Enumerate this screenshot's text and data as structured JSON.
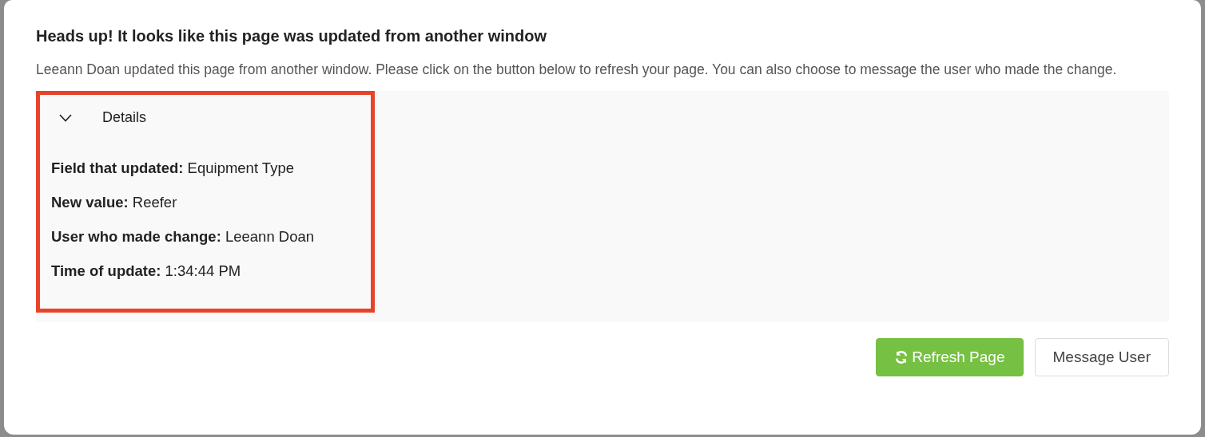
{
  "dialog": {
    "title": "Heads up! It looks like this page was updated from another window",
    "message": "Leeann Doan updated this page from another window. Please click on the button below to refresh your page. You can also choose to message the user who made the change.",
    "details": {
      "label": "Details",
      "expanded": true,
      "highlighted": true,
      "items": [
        {
          "label": "Field that updated:",
          "value": "Equipment Type"
        },
        {
          "label": "New value:",
          "value": "Reefer"
        },
        {
          "label": "User who made change:",
          "value": "Leeann Doan"
        },
        {
          "label": "Time of update:",
          "value": "1:34:44 PM"
        }
      ]
    },
    "buttons": [
      {
        "label": "Refresh Page",
        "kind": "primary"
      },
      {
        "label": "Message User",
        "kind": "secondary"
      }
    ]
  }
}
